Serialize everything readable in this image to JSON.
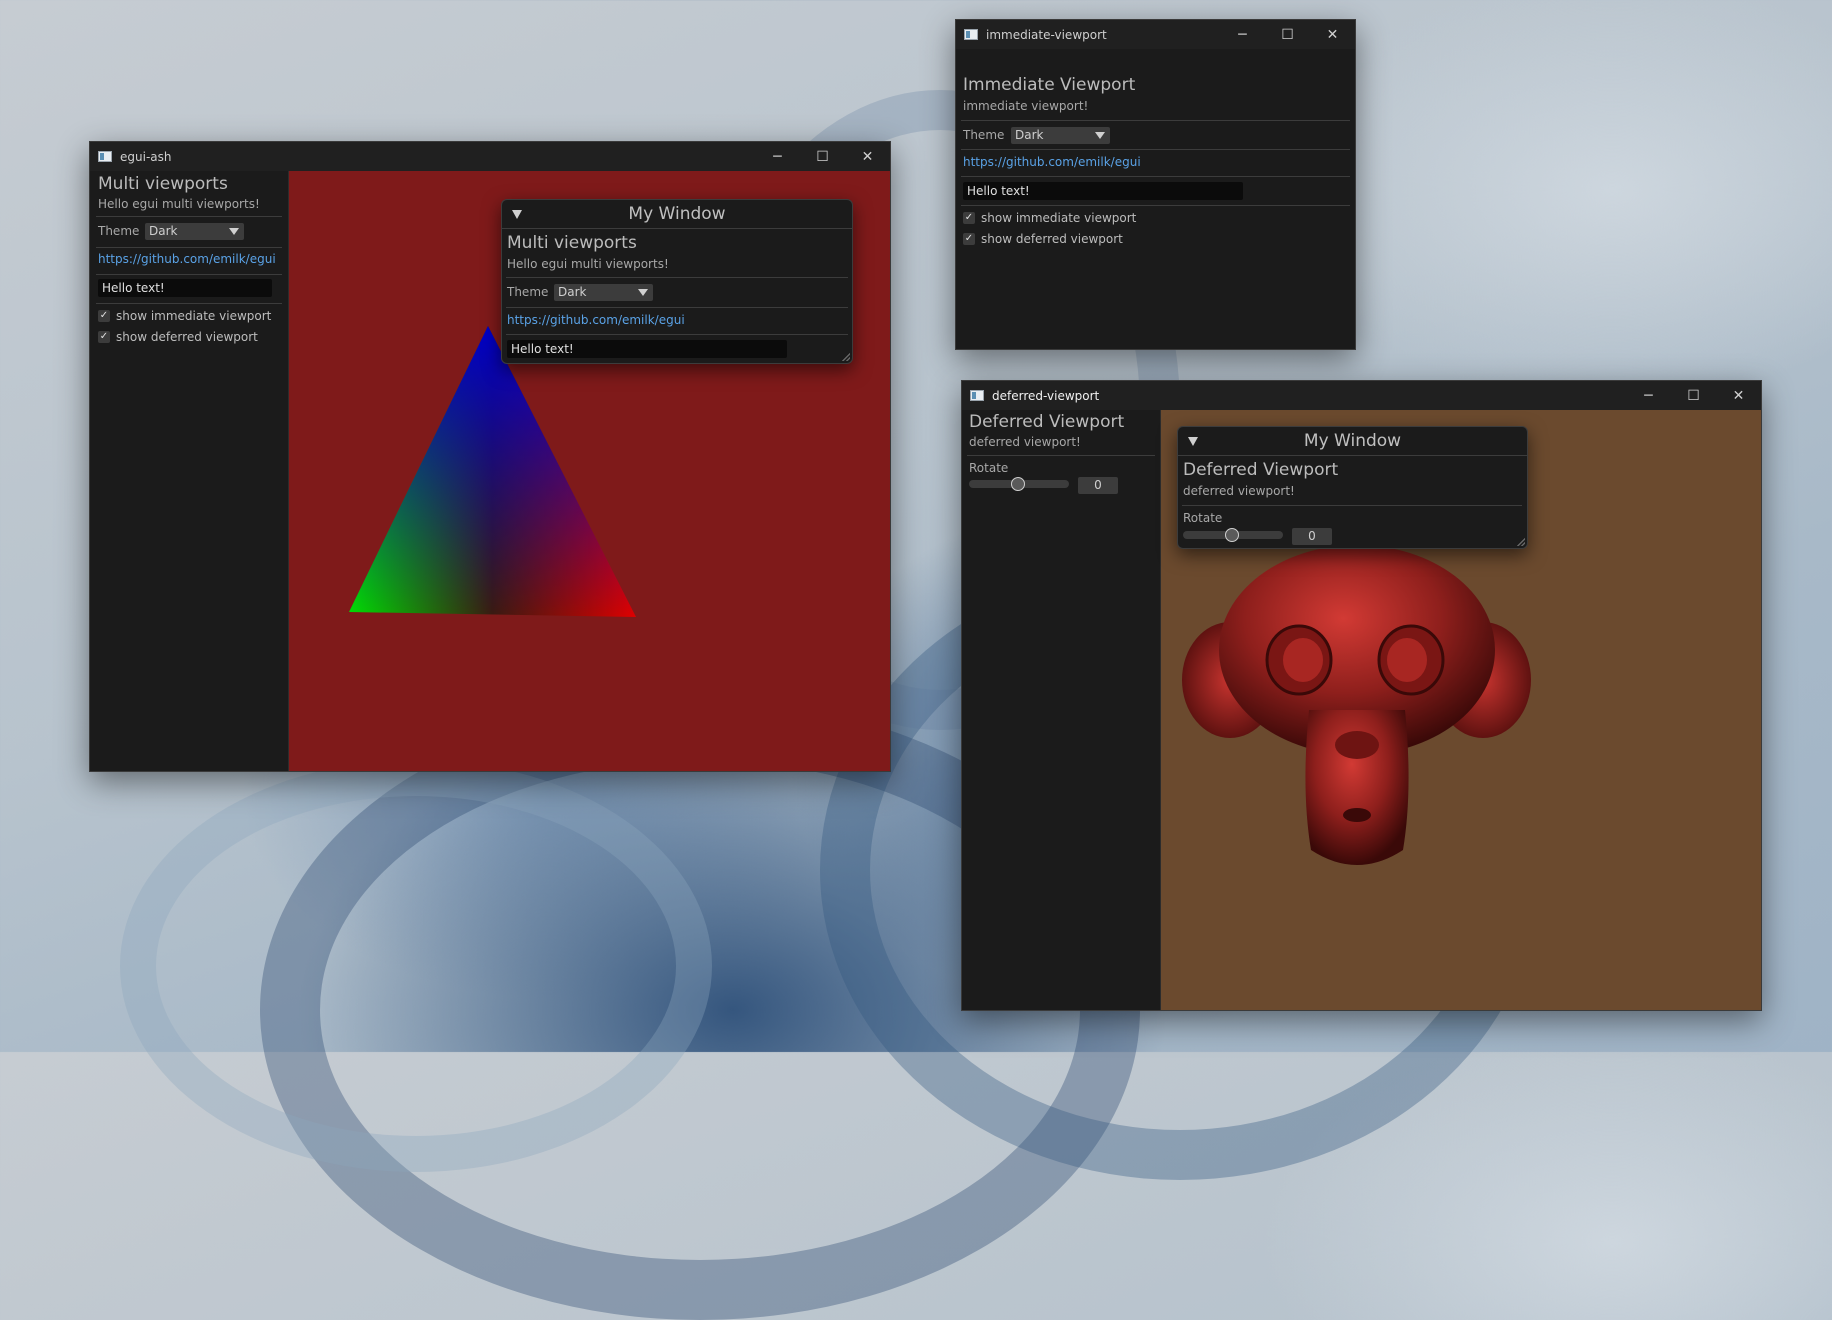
{
  "colors": {
    "panel": "#1b1b1b",
    "red_canvas": "#7f1a1a",
    "brown_canvas": "#6b4a2e",
    "link": "#5aa2e6"
  },
  "egui_ash": {
    "window_title": "egui-ash",
    "panel": {
      "heading": "Multi viewports",
      "subtitle": "Hello egui multi viewports!",
      "theme_label": "Theme",
      "theme_value": "Dark",
      "link": "https://github.com/emilk/egui",
      "text_input": "Hello text!",
      "checkbox_immediate": "show immediate viewport",
      "checkbox_deferred": "show deferred viewport",
      "checkmark": "✓"
    },
    "my_window": {
      "title": "My Window",
      "heading": "Multi viewports",
      "subtitle": "Hello egui multi viewports!",
      "theme_label": "Theme",
      "theme_value": "Dark",
      "link": "https://github.com/emilk/egui",
      "text_input": "Hello text!"
    }
  },
  "immediate_viewport": {
    "window_title": "immediate-viewport",
    "heading": "Immediate Viewport",
    "subtitle": "immediate viewport!",
    "theme_label": "Theme",
    "theme_value": "Dark",
    "link": "https://github.com/emilk/egui",
    "text_input": "Hello text!",
    "checkbox_immediate": "show immediate viewport",
    "checkbox_deferred": "show deferred viewport",
    "checkmark": "✓"
  },
  "deferred_viewport": {
    "window_title": "deferred-viewport",
    "panel": {
      "heading": "Deferred Viewport",
      "subtitle": "deferred viewport!",
      "rotate_label": "Rotate",
      "rotate_value": "0"
    },
    "my_window": {
      "title": "My Window",
      "heading": "Deferred Viewport",
      "subtitle": "deferred viewport!",
      "rotate_label": "Rotate",
      "rotate_value": "0"
    }
  },
  "window_controls": {
    "minimize": "─",
    "maximize": "☐",
    "close": "✕"
  }
}
